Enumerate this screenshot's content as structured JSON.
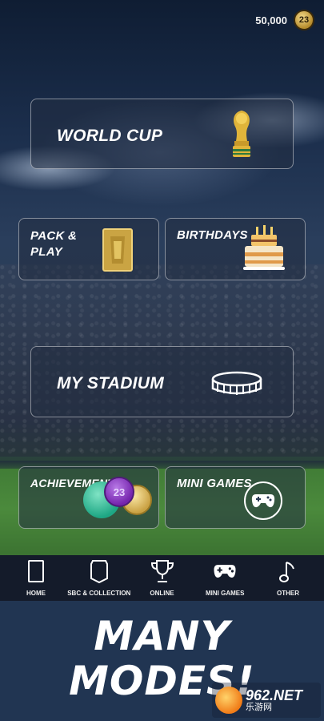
{
  "header": {
    "coins": "50,000",
    "coin_badge": "23"
  },
  "tiles": {
    "world_cup": "WORLD CUP",
    "pack_play": "PACK & PLAY",
    "birthdays": "BIRTHDAYS",
    "my_stadium": "MY STADIUM",
    "achievements": "ACHIEVEMENTS",
    "achievements_badge": "23",
    "mini_games": "MINI GAMES"
  },
  "nav": {
    "items": [
      {
        "label": "HOME",
        "icon": "card-icon"
      },
      {
        "label": "SBC & COLLECTION",
        "icon": "shield-card-icon"
      },
      {
        "label": "ONLINE",
        "icon": "trophy-icon"
      },
      {
        "label": "MINI GAMES",
        "icon": "gamepad-icon"
      },
      {
        "label": "OTHER",
        "icon": "music-note-icon"
      }
    ]
  },
  "promo": {
    "line1": "MANY",
    "line2": "MODES!"
  },
  "watermark": {
    "text": "962.NET",
    "sub": "乐游网"
  }
}
